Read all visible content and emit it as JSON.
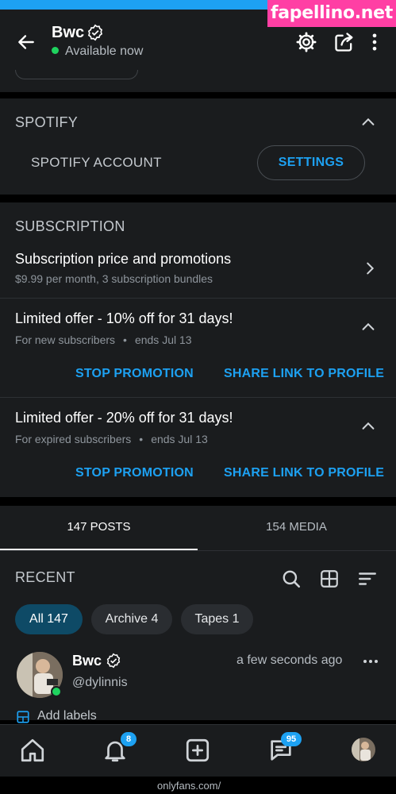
{
  "watermark": "fapellino.net",
  "header": {
    "name": "Bwc",
    "status": "Available now",
    "icons": [
      "back-arrow-icon",
      "verified-icon",
      "gear-icon",
      "share-icon",
      "more-vertical-icon"
    ]
  },
  "spotify": {
    "title": "SPOTIFY",
    "account_label": "SPOTIFY ACCOUNT",
    "settings_button": "SETTINGS"
  },
  "subscription": {
    "title": "SUBSCRIPTION",
    "price_row": {
      "title": "Subscription price and promotions",
      "subtitle": "$9.99 per month, 3 subscription bundles"
    },
    "offers": [
      {
        "title": "Limited offer - 10% off for 31 days!",
        "audience": "For new subscribers",
        "ends": "ends Jul 13",
        "stop_label": "STOP PROMOTION",
        "share_label": "SHARE LINK TO PROFILE"
      },
      {
        "title": "Limited offer - 20% off for 31 days!",
        "audience": "For expired subscribers",
        "ends": "ends Jul 13",
        "stop_label": "STOP PROMOTION",
        "share_label": "SHARE LINK TO PROFILE"
      }
    ]
  },
  "tabs": [
    {
      "label": "147 POSTS",
      "active": true
    },
    {
      "label": "154 MEDIA",
      "active": false
    }
  ],
  "recent": {
    "title": "RECENT",
    "chips": [
      {
        "label": "All 147",
        "active": true
      },
      {
        "label": "Archive 4",
        "active": false
      },
      {
        "label": "Tapes 1",
        "active": false
      }
    ]
  },
  "post": {
    "author": "Bwc",
    "handle": "@dylinnis",
    "time": "a few seconds ago",
    "add_labels": "Add labels"
  },
  "bottom_nav": {
    "notifications_badge": "8",
    "messages_badge": "95"
  },
  "url_fragment": "onlyfans.com/"
}
